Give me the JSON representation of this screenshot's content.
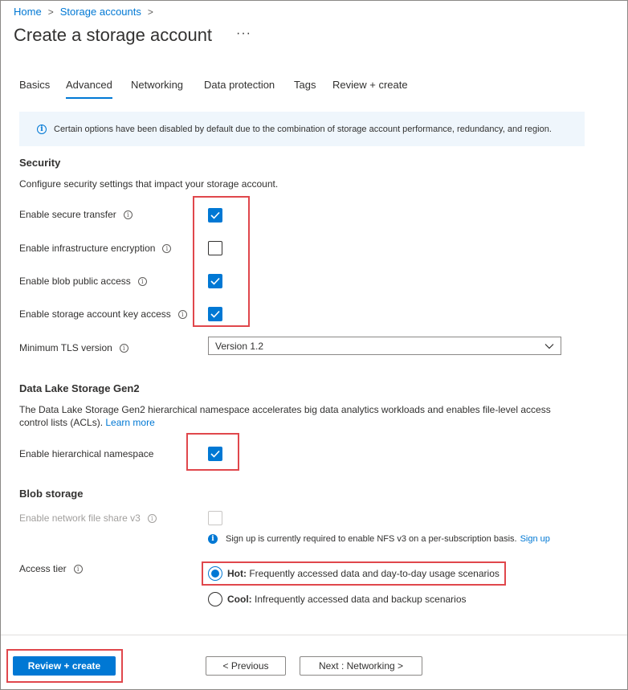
{
  "breadcrumb": {
    "items": [
      "Home",
      "Storage accounts"
    ],
    "separator": ">"
  },
  "page": {
    "title": "Create a storage account",
    "more": "···"
  },
  "tabs": [
    {
      "label": "Basics",
      "active": false
    },
    {
      "label": "Advanced",
      "active": true
    },
    {
      "label": "Networking",
      "active": false
    },
    {
      "label": "Data protection",
      "active": false
    },
    {
      "label": "Tags",
      "active": false
    },
    {
      "label": "Review + create",
      "active": false
    }
  ],
  "banner": {
    "text": "Certain options have been disabled by default due to the combination of storage account performance, redundancy, and region."
  },
  "security": {
    "heading": "Security",
    "description": "Configure security settings that impact your storage account.",
    "secure_transfer": {
      "label": "Enable secure transfer",
      "checked": true
    },
    "infra_encryption": {
      "label": "Enable infrastructure encryption",
      "checked": false
    },
    "blob_public": {
      "label": "Enable blob public access",
      "checked": true
    },
    "key_access": {
      "label": "Enable storage account key access",
      "checked": true
    },
    "tls": {
      "label": "Minimum TLS version",
      "value": "Version 1.2"
    }
  },
  "datalake": {
    "heading": "Data Lake Storage Gen2",
    "description": "The Data Lake Storage Gen2 hierarchical namespace accelerates big data analytics workloads and enables file-level access control lists (ACLs).",
    "learn_more": "Learn more",
    "hns": {
      "label": "Enable hierarchical namespace",
      "checked": true
    }
  },
  "blob": {
    "heading": "Blob storage",
    "nfs": {
      "label": "Enable network file share v3",
      "checked": false,
      "disabled": true
    },
    "nfs_note": "Sign up is currently required to enable NFS v3 on a per-subscription basis.",
    "nfs_signup": "Sign up",
    "access_tier": {
      "label": "Access tier",
      "hot": {
        "name": "Hot:",
        "desc": "Frequently accessed data and day-to-day usage scenarios",
        "selected": true
      },
      "cool": {
        "name": "Cool:",
        "desc": "Infrequently accessed data and backup scenarios",
        "selected": false
      }
    }
  },
  "footer": {
    "review": "Review + create",
    "previous": "< Previous",
    "next": "Next : Networking >"
  },
  "colors": {
    "accent": "#0078d4",
    "highlight": "#e0474c"
  }
}
